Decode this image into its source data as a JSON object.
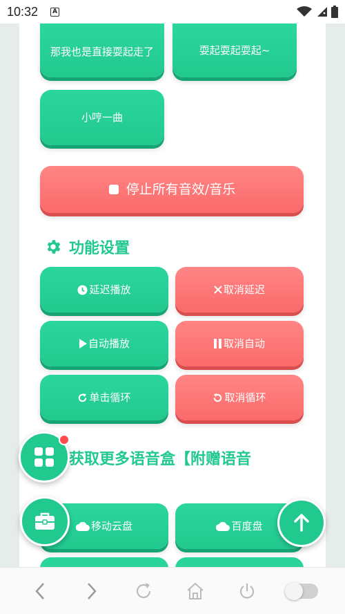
{
  "status_bar": {
    "time": "10:32",
    "notification_letter": "A"
  },
  "sound_buttons": [
    {
      "label": "那我也是直接耍起走了"
    },
    {
      "label": "耍起耍起耍起~"
    },
    {
      "label": "小哼一曲"
    }
  ],
  "stop_all_label": "停止所有音效/音乐",
  "settings": {
    "title": "功能设置",
    "buttons": [
      {
        "label": "延迟播放",
        "icon": "clock-icon",
        "color": "green"
      },
      {
        "label": "取消延迟",
        "icon": "close-icon",
        "color": "red"
      },
      {
        "label": "自动播放",
        "icon": "play-icon",
        "color": "green"
      },
      {
        "label": "取消自动",
        "icon": "pause-icon",
        "color": "red"
      },
      {
        "label": "单击循环",
        "icon": "redo-icon",
        "color": "green"
      },
      {
        "label": "取消循环",
        "icon": "undo-icon",
        "color": "red"
      }
    ]
  },
  "more_section": {
    "title": "获取更多语音盒【附赠语音",
    "buttons": [
      {
        "label": "移动云盘",
        "icon": "cloud-icon"
      },
      {
        "label": "百度盘",
        "icon": "cloud-icon"
      }
    ]
  },
  "colors": {
    "green": "#22c98f",
    "red": "#fb6a6a",
    "badge": "#ff4d4f"
  },
  "bottom_nav": [
    "back-icon",
    "forward-icon",
    "refresh-icon",
    "home-icon",
    "power-icon",
    "toggle"
  ]
}
